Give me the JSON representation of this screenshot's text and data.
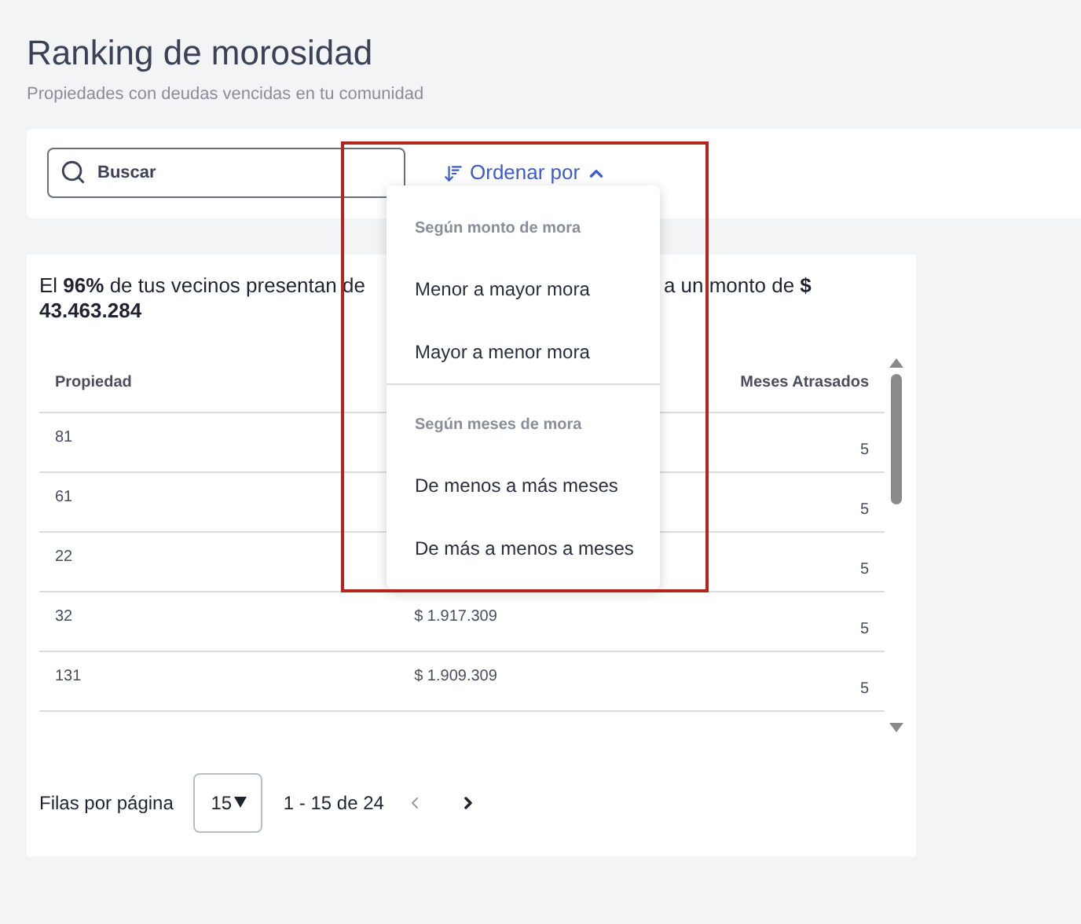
{
  "page": {
    "title": "Ranking de morosidad",
    "subtitle": "Propiedades con deudas vencidas en tu comunidad"
  },
  "search": {
    "placeholder": "Buscar"
  },
  "sort_button": {
    "label": "Ordenar por",
    "expanded": true
  },
  "sort_menu": {
    "sections": [
      {
        "heading": "Según monto de mora",
        "items": [
          "Menor a mayor mora",
          "Mayor a menor mora"
        ]
      },
      {
        "heading": "Según meses de mora",
        "items": [
          "De menos a más meses",
          "De más a menos a meses"
        ]
      }
    ]
  },
  "summary": {
    "left": "El **96%** de tus vecinos presentan de",
    "right": "a un monto de **$**",
    "amount": "43.463.284"
  },
  "table": {
    "columns": {
      "column_1": "Propiedad",
      "column_3": "Meses Atrasados"
    },
    "rows": [
      {
        "column_1": "81",
        "column_3": "5"
      },
      {
        "column_1": "61",
        "column_3": "5"
      },
      {
        "column_1": "22",
        "column_3": "5"
      },
      {
        "column_1": "32",
        "column_2": "$ 1.917.309",
        "column_3": "5"
      },
      {
        "column_1": "131",
        "column_2": "$ 1.909.309",
        "column_3": "5"
      }
    ]
  },
  "pagination": {
    "rows_per_page_label": "Filas por página",
    "rows_per_page": "15",
    "range": "1 - 15 de 24",
    "prev_disabled": true,
    "next_disabled": false
  }
}
